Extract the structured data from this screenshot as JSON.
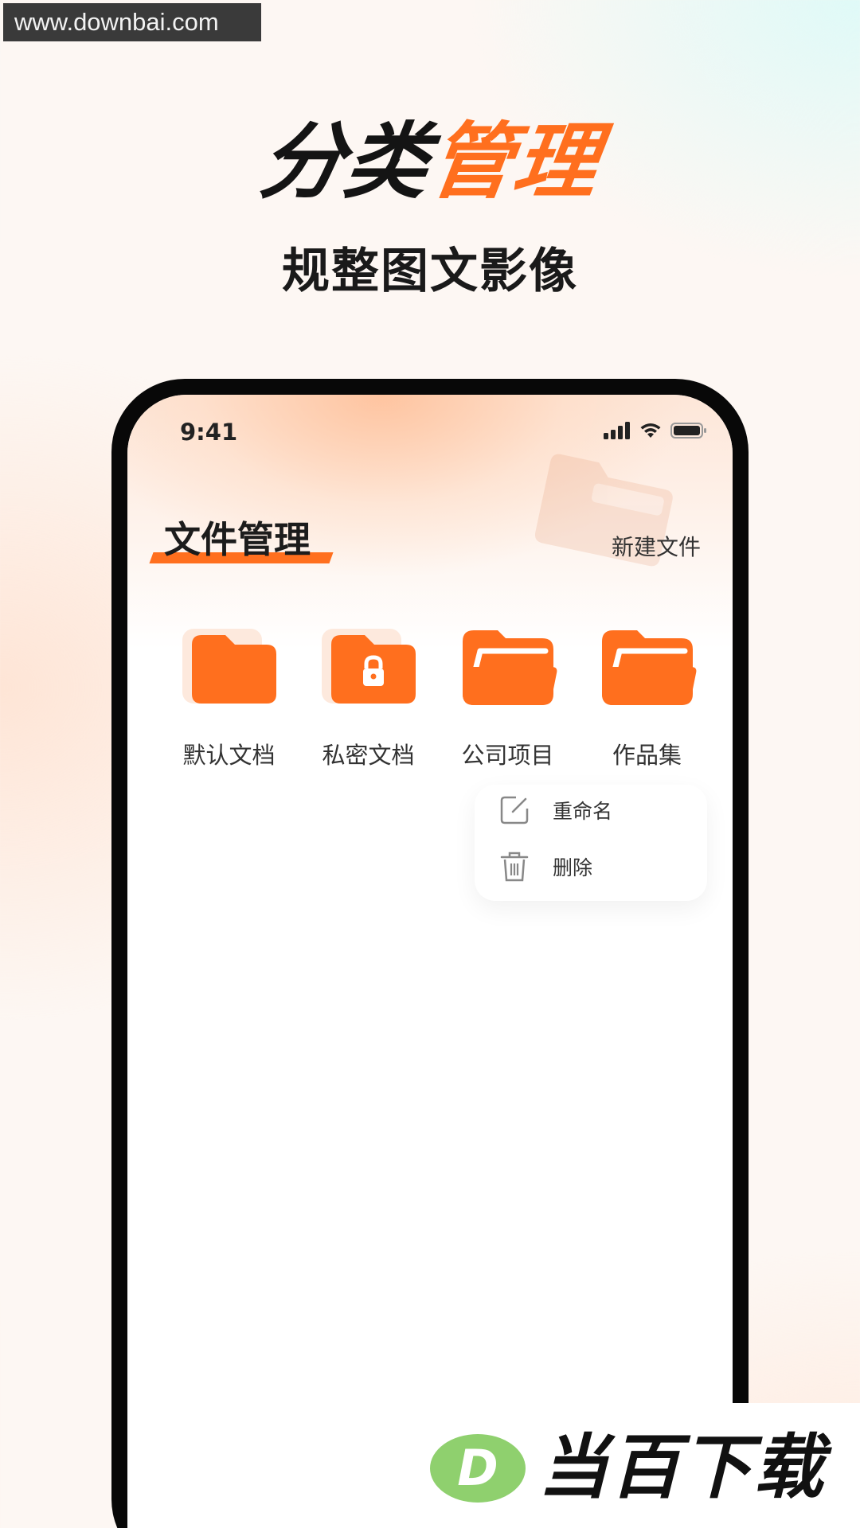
{
  "watermark": {
    "text": "www.downbai.com"
  },
  "promo": {
    "headline_dark": "分类",
    "headline_accent": "管理",
    "subheadline": "规整图文影像"
  },
  "status_bar": {
    "time": "9:41"
  },
  "screen": {
    "title": "文件管理",
    "new_file_label": "新建文件",
    "folders": [
      {
        "label": "默认文档",
        "icon": "folder-icon"
      },
      {
        "label": "私密文档",
        "icon": "lock-folder-icon"
      },
      {
        "label": "公司项目",
        "icon": "open-folder-icon"
      },
      {
        "label": "作品集",
        "icon": "open-folder-icon"
      }
    ],
    "context_menu": {
      "rename_label": "重命名",
      "delete_label": "删除"
    }
  },
  "brand": {
    "name": "当百下载",
    "logo_letter": "D"
  },
  "colors": {
    "accent": "#ff6f1e",
    "text": "#333333",
    "brand_green": "#8fd06e"
  }
}
